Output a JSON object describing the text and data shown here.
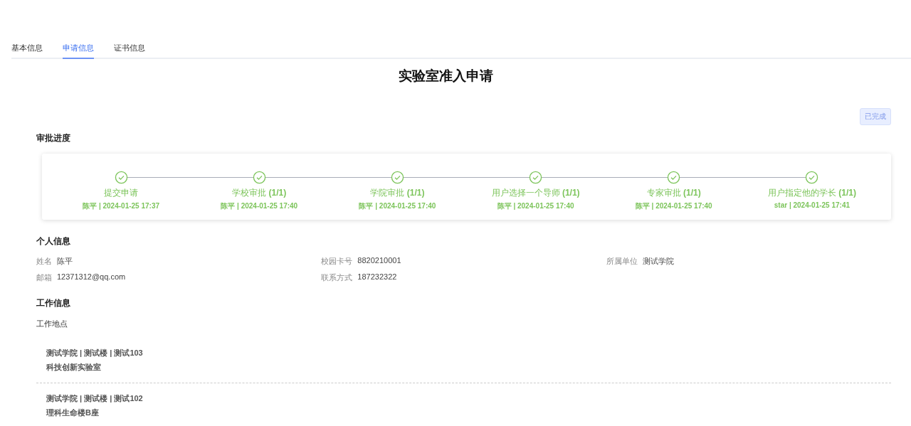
{
  "tabs": [
    {
      "label": "基本信息",
      "selected": false
    },
    {
      "label": "申请信息",
      "selected": true
    },
    {
      "label": "证书信息",
      "selected": false
    }
  ],
  "title": "实验室准入申请",
  "status_badge": "已完成",
  "progress": {
    "heading": "审批进度",
    "steps": [
      {
        "title": "提交申请",
        "meta": "陈平 **| 2024-01-25 17:37**",
        "done": true
      },
      {
        "title": "学校审批 **(1/1)**",
        "meta": "陈平 **| 2024-01-25 17:40**",
        "done": true
      },
      {
        "title": "学院审批 **(1/1)**",
        "meta": "陈平 **| 2024-01-25 17:40**",
        "done": true
      },
      {
        "title": "用户选择一个导师 **(1/1)**",
        "meta": "陈平 **| 2024-01-25 17:40**",
        "done": true
      },
      {
        "title": "专家审批 **(1/1)**",
        "meta": "陈平 **| 2024-01-25 17:40**",
        "done": true
      },
      {
        "title": "用户指定他的学长 **(1/1)**",
        "meta": "star | 2024-01-25 17:41",
        "done": true
      }
    ]
  },
  "personal": {
    "heading": "个人信息",
    "fields": [
      {
        "label": "姓名",
        "value": "陈平"
      },
      {
        "label": "校园卡号",
        "value": "8820210001"
      },
      {
        "label": "所属单位",
        "value": "测试学院"
      },
      {
        "label": "邮箱",
        "value": "12371312@qq.com"
      },
      {
        "label": "联系方式",
        "value": "187232322"
      }
    ]
  },
  "work": {
    "heading": "工作信息",
    "subheading": "工作地点",
    "locations": [
      {
        "path": "测试学院 | 测试楼 | 测试103",
        "name": "科技创新实验室"
      },
      {
        "path": "测试学院 | 测试楼 | 测试102",
        "name": "理科生命楼B座"
      }
    ]
  }
}
